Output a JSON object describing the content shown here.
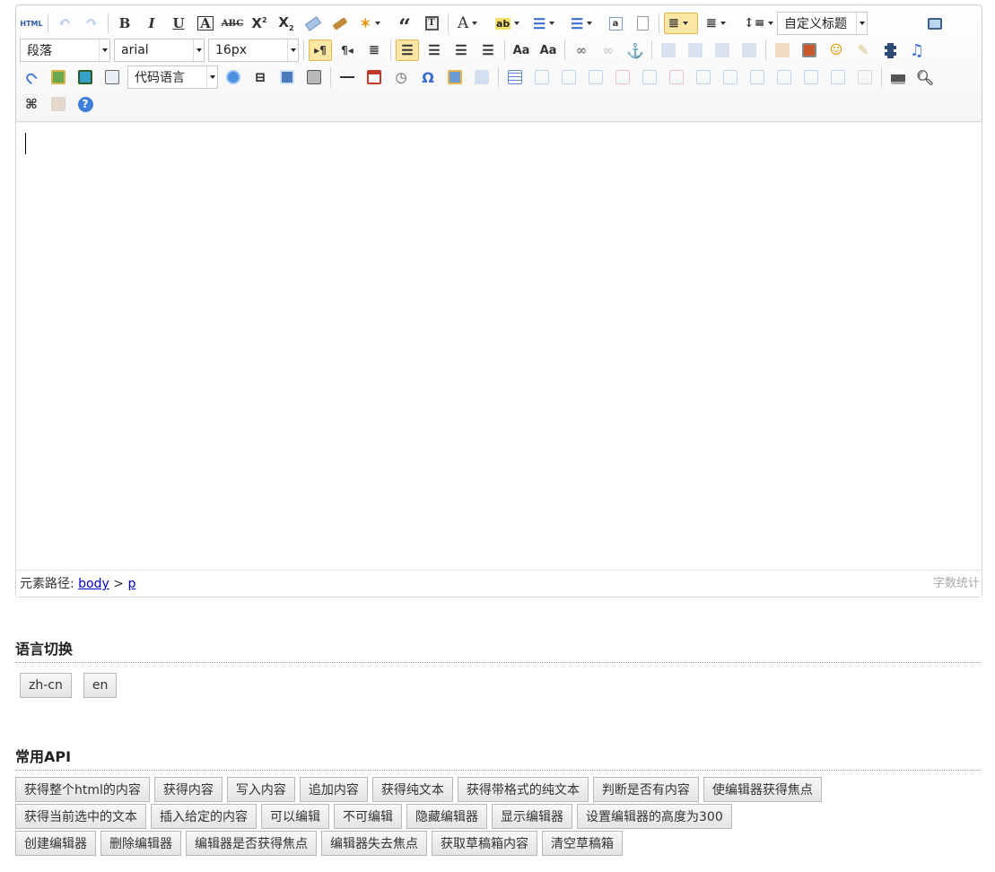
{
  "toolbar": {
    "paragraph_select": "段落",
    "font_family_select": "arial",
    "font_size_select": "16px",
    "code_language_select": "代码语言",
    "custom_heading_select": "自定义标题",
    "html_source_label": "HTML"
  },
  "editor": {
    "element_path_label": "元素路径:",
    "path_body": "body",
    "path_separator": ">",
    "path_p": "p",
    "word_count_label": "字数统计"
  },
  "language_section": {
    "title": "语言切换",
    "buttons": [
      "zh-cn",
      "en"
    ]
  },
  "api_section": {
    "title": "常用API",
    "row1": [
      "获得整个html的内容",
      "获得内容",
      "写入内容",
      "追加内容",
      "获得纯文本",
      "获得带格式的纯文本",
      "判断是否有内容",
      "使编辑器获得焦点"
    ],
    "row2": [
      "获得当前选中的文本",
      "插入给定的内容",
      "可以编辑",
      "不可编辑",
      "隐藏编辑器",
      "显示编辑器",
      "设置编辑器的高度为300"
    ],
    "row3": [
      "创建编辑器",
      "删除编辑器",
      "编辑器是否获得焦点",
      "编辑器失去焦点",
      "获取草稿箱内容",
      "清空草稿箱"
    ]
  }
}
